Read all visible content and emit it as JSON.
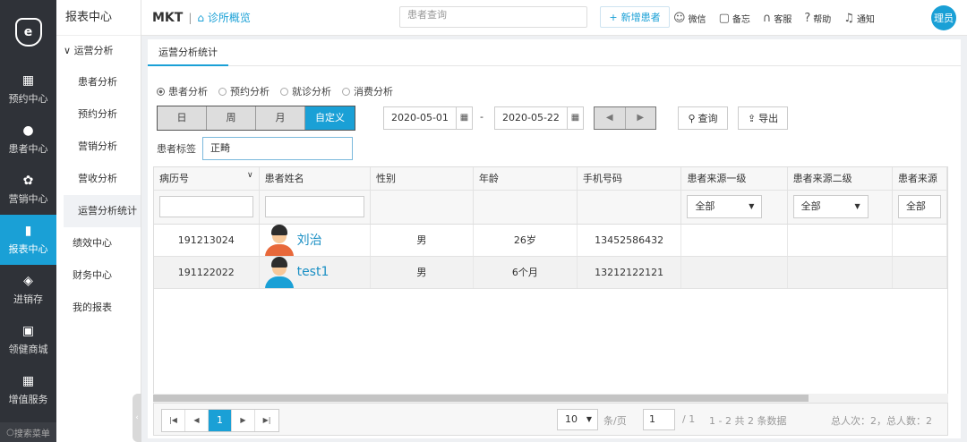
{
  "rail": {
    "logo_glyph": "e",
    "items": [
      {
        "label": "预约中心",
        "icon": "calendar-icon",
        "glyph": "▦"
      },
      {
        "label": "患者中心",
        "icon": "user-icon",
        "glyph": "●"
      },
      {
        "label": "营销中心",
        "icon": "marketing-icon",
        "glyph": "✿"
      },
      {
        "label": "报表中心",
        "icon": "chart-icon",
        "glyph": "▮"
      },
      {
        "label": "进销存",
        "icon": "layers-icon",
        "glyph": "◈"
      },
      {
        "label": "领健商城",
        "icon": "shop-icon",
        "glyph": "▣"
      },
      {
        "label": "增值服务",
        "icon": "grid-icon",
        "glyph": "▦"
      }
    ],
    "search": "搜索菜单"
  },
  "submenu": {
    "title": "报表中心",
    "group": "运营分析",
    "group_items": [
      "患者分析",
      "预约分析",
      "营销分析",
      "营收分析",
      "运营分析统计"
    ],
    "items": [
      "绩效中心",
      "财务中心",
      "我的报表"
    ]
  },
  "topbar": {
    "brand": "MKT",
    "crumb": "诊所概览",
    "search_placeholder": "患者查询",
    "add_label": "新增患者",
    "tools": [
      {
        "label": "微信",
        "icon": "wechat-icon",
        "glyph": "☺"
      },
      {
        "label": "备忘",
        "icon": "memo-icon",
        "glyph": "▢"
      },
      {
        "label": "客服",
        "icon": "headset-icon",
        "glyph": "∩"
      },
      {
        "label": "帮助",
        "icon": "help-icon",
        "glyph": "?"
      },
      {
        "label": "通知",
        "icon": "bell-icon",
        "glyph": "♫"
      }
    ],
    "avatar": "理员"
  },
  "main": {
    "tab": "运营分析统计",
    "radios": [
      "患者分析",
      "预约分析",
      "就诊分析",
      "消费分析"
    ],
    "periods": [
      "日",
      "周",
      "月",
      "自定义"
    ],
    "date_start": "2020-05-01",
    "date_end": "2020-05-22",
    "dash": "-",
    "query_label": "查询",
    "export_label": "导出",
    "tag_label": "患者标签",
    "tag_value": "正畸"
  },
  "grid": {
    "columns": [
      "病历号",
      "患者姓名",
      "性别",
      "年龄",
      "手机号码",
      "患者来源一级",
      "患者来源二级",
      "患者来源"
    ],
    "filter_select": "全部",
    "rows": [
      {
        "id": "191213024",
        "name": "刘治",
        "gender": "男",
        "age": "26岁",
        "phone": "13452586432"
      },
      {
        "id": "191122022",
        "name": "test1",
        "gender": "男",
        "age": "6个月",
        "phone": "13212122121"
      }
    ]
  },
  "pager": {
    "current_page": "1",
    "page_size": "10",
    "per_page_label": "条/页",
    "page_input": "1",
    "total_pages": "/ 1",
    "range": "1 - 2 共 2 条数据",
    "summary": "总人次：2，总人数：2"
  }
}
